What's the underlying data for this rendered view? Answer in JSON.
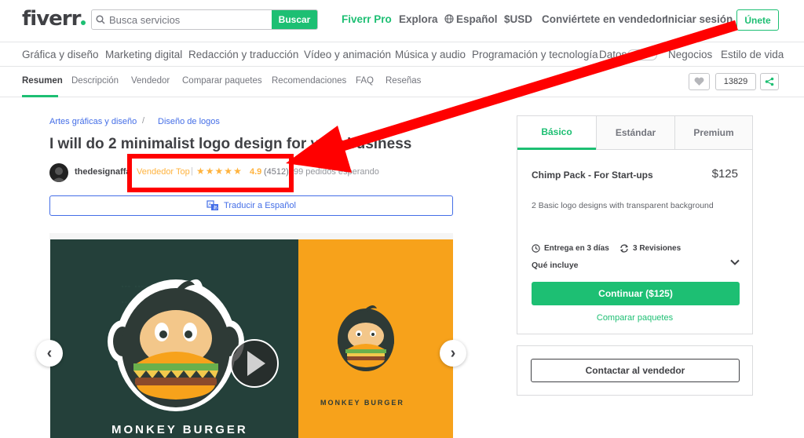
{
  "header": {
    "logo": "fiverr",
    "search_placeholder": "Busca servicios",
    "search_button": "Buscar",
    "nav": [
      "Fiverr Pro",
      "Explora",
      "Español",
      "$USD",
      "Conviértete en vendedor",
      "Iniciar sesión"
    ],
    "join_button": "Únete"
  },
  "categories": [
    "Gráfica y diseño",
    "Marketing digital",
    "Redacción y traducción",
    "Vídeo y animación",
    "Música y audio",
    "Programación y tecnología",
    "Datos",
    "Negocios",
    "Estilo de vida"
  ],
  "subnav": {
    "tabs": [
      "Resumen",
      "Descripción",
      "Vendedor",
      "Comparar paquetes",
      "Recomendaciones",
      "FAQ",
      "Reseñas"
    ],
    "favorite_count": "13829"
  },
  "breadcrumb": [
    "Artes gráficas y diseño",
    "Diseño de logos"
  ],
  "breadcrumb_separator": "/",
  "gig": {
    "title": "I will do 2 minimalist logo design for your business",
    "seller": "thedesignaffa",
    "seller_level": "Vendedor Top",
    "separator": "|",
    "rating": "4.9",
    "reviews": "(4512)",
    "orders_in_queue": "99 pedidos esperando",
    "translate": "Traducir a Español"
  },
  "gallery": {
    "brand_large": "MONKEY BURGER",
    "brand_small": "MONKEY BURGER",
    "prev": "‹",
    "next": "›"
  },
  "package": {
    "tabs": [
      "Básico",
      "Estándar",
      "Premium"
    ],
    "name": "Chimp Pack - For Start-ups",
    "price": "$125",
    "description": "2 Basic logo designs with transparent background",
    "delivery": "Entrega en 3 días",
    "revisions": "3 Revisiones",
    "includes": "Qué incluye",
    "continue": "Continuar ($125)",
    "compare": "Comparar paquetes"
  },
  "contact": "Contactar al vendedor",
  "colors": {
    "brand_green": "#1dbf73",
    "star_gold": "#ffb33e",
    "link_blue": "#446ee7",
    "annotation_red": "#ff0000",
    "gallery_dark": "#24403a",
    "gallery_orange": "#f7a21b"
  }
}
